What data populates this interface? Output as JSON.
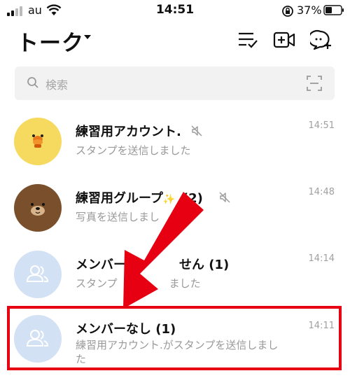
{
  "status_bar": {
    "carrier": "au",
    "time": "14:51",
    "battery": "37%"
  },
  "header": {
    "title": "トーク"
  },
  "search": {
    "placeholder": "検索"
  },
  "chats": [
    {
      "name": "練習用アカウント.",
      "message": "スタンプを送信しました",
      "time": "14:51",
      "muted": true
    },
    {
      "name": "練習用グループ",
      "count": "(2)",
      "message": "写真を送信しまし",
      "time": "14:48",
      "muted": true
    },
    {
      "name": "メンバー",
      "name_suffix": "せん",
      "count": "(1)",
      "message": "スタンプ",
      "message_suffix": "ました",
      "time": "14:14"
    },
    {
      "name": "メンバーなし",
      "count": "(1)",
      "message": "練習用アカウント.がスタンプを送信しまし",
      "message_line2": "た",
      "time": "14:11"
    }
  ],
  "colors": {
    "accent_red": "#e60012",
    "avatar_yellow": "#f6da5f",
    "avatar_brown": "#7a4f2c",
    "avatar_blue": "#d3e1f5"
  }
}
